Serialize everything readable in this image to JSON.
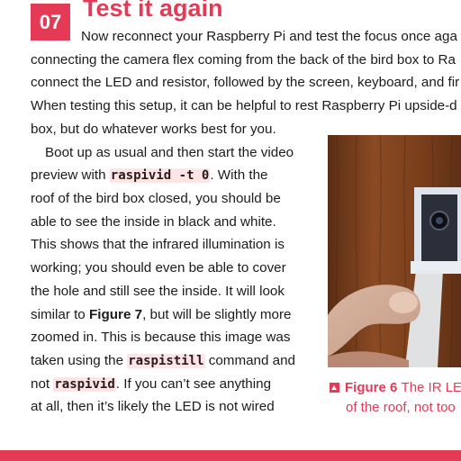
{
  "step": {
    "number": "07",
    "title": "Test it again"
  },
  "intro_lines": [
    "Now reconnect your Raspberry Pi and test the focus once aga",
    "connecting the camera flex coming from the back of the bird box to Ra",
    "connect the LED and resistor, followed by the screen, keyboard, and fir",
    "When testing this setup, it can be helpful to rest Raspberry Pi upside-d",
    "box, but do whatever works best for you."
  ],
  "body": {
    "l1": "Boot up as usual and then start the video",
    "l2_pre": "preview with ",
    "l2_code": "raspivid -t 0",
    "l2_post": ". With the",
    "l3": "roof of the bird box closed, you should be",
    "l4": "able to see the inside in black and white.",
    "l5": "This shows that the infrared illumination is",
    "l6": "working; you should even be able to cover",
    "l7": "the hole and still see the inside. It will look",
    "l8_pre": "similar to ",
    "l8_bold": "Figure 7",
    "l8_post": ", but will be slightly more",
    "l9": "zoomed in. This is because this image was",
    "l10_pre": "taken using the ",
    "l10_code": "raspistill",
    "l10_post": " command and",
    "l11_pre": "not ",
    "l11_code": "raspivid",
    "l11_post": ". If you can’t see anything",
    "l12": "at all, then it’s likely the LED is not wired"
  },
  "caption": {
    "figure_label": "Figure 6",
    "line1": "The IR LE",
    "line2": "of the roof, not too"
  },
  "colors": {
    "accent": "#e53a56",
    "code_bg": "#fde4e7"
  }
}
